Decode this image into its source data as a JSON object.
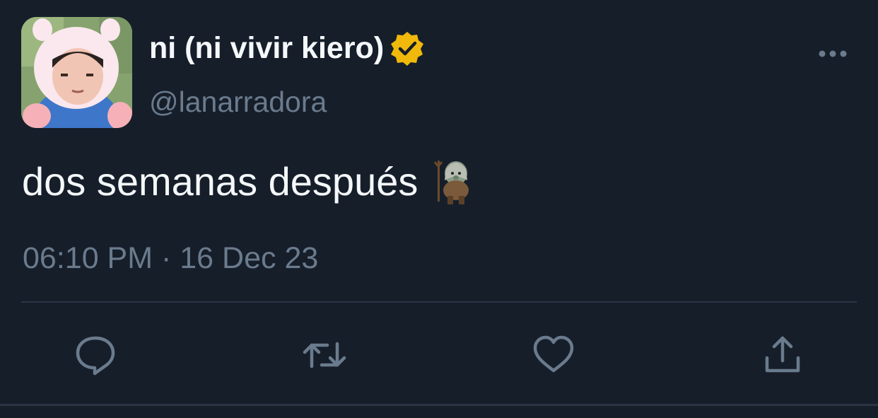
{
  "user": {
    "display_name": "ni (ni vivir kiero)",
    "handle": "@lanarradora",
    "verified_badge": "verified-gold-icon"
  },
  "tweet": {
    "text": "dos semanas después",
    "emoji": "troll-figure-emoji",
    "timestamp": "06:10 PM · 16 Dec 23"
  },
  "actions": [
    {
      "name": "reply",
      "icon": "speech-bubble-icon"
    },
    {
      "name": "retweet",
      "icon": "retweet-arrows-icon"
    },
    {
      "name": "like",
      "icon": "heart-icon"
    },
    {
      "name": "share",
      "icon": "share-upload-icon"
    }
  ],
  "colors": {
    "background": "#161e2a",
    "text": "#f5f8fa",
    "secondary": "#6a7b8d",
    "badge": "#f0b90b"
  }
}
